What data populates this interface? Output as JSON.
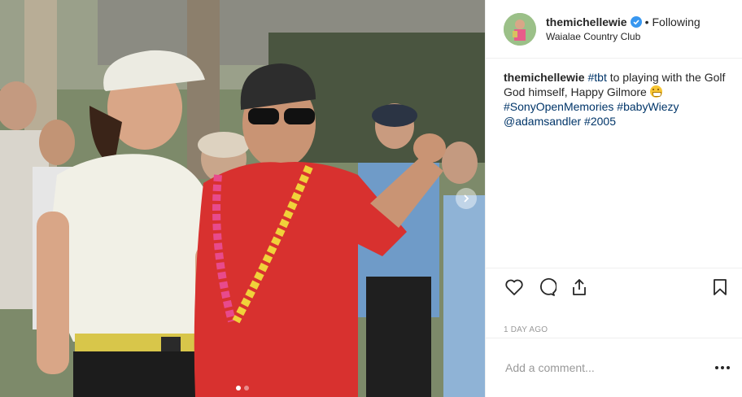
{
  "post": {
    "media": {
      "alt": "",
      "carousel_total": 2,
      "carousel_active": 1,
      "next_icon": "chevron-right-icon"
    },
    "header": {
      "username": "themichellewie",
      "verified": true,
      "separator": "•",
      "follow_status": "Following",
      "location": "Waialae Country Club"
    },
    "caption": {
      "username": "themichellewie",
      "segments": [
        {
          "type": "hashtag",
          "text": "#tbt"
        },
        {
          "type": "text",
          "text": " to playing with the Golf God himself, Happy Gilmore "
        },
        {
          "type": "emoji",
          "name": "grinning-face-emoji"
        },
        {
          "type": "text",
          "text": " "
        },
        {
          "type": "hashtag",
          "text": "#SonyOpenMemories"
        },
        {
          "type": "text",
          "text": " "
        },
        {
          "type": "hashtag",
          "text": "#babyWiezy"
        },
        {
          "type": "text",
          "text": " "
        },
        {
          "type": "mention",
          "text": "@adamsandler"
        },
        {
          "type": "text",
          "text": " "
        },
        {
          "type": "hashtag",
          "text": "#2005"
        }
      ]
    },
    "actions": {
      "like_icon": "heart-icon",
      "comment_icon": "comment-icon",
      "share_icon": "share-icon",
      "save_icon": "bookmark-icon"
    },
    "timestamp": "1 DAY AGO",
    "comment_box": {
      "placeholder": "Add a comment...",
      "value": "",
      "more_icon": "more-options-icon"
    },
    "colors": {
      "link": "#003569",
      "verified": "#3897f0",
      "muted": "#999999",
      "border": "#efefef"
    }
  }
}
